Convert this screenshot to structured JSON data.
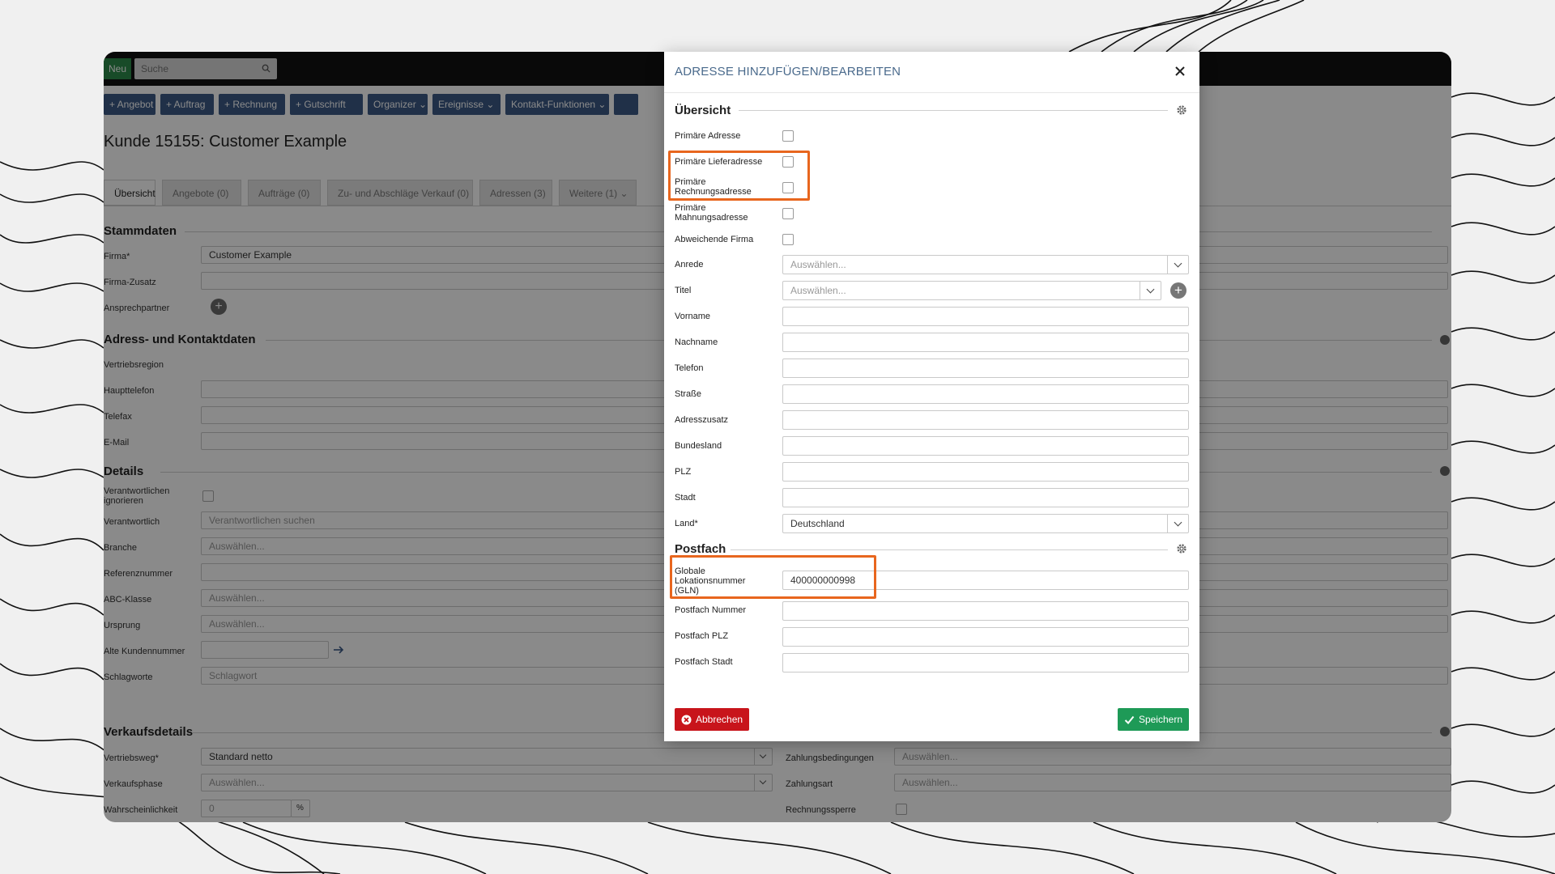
{
  "topbar": {
    "new_label": "Neu",
    "search_placeholder": "Suche"
  },
  "toolbar": {
    "buttons": [
      "+ Angebot",
      "+ Auftrag",
      "+ Rechnung",
      "+ Gutschrift",
      "Organizer ⌄",
      "Ereignisse ⌄",
      "Kontakt-Funktionen ⌄"
    ]
  },
  "page": {
    "title": "Kunde 15155: Customer Example",
    "tabs": [
      "Übersicht",
      "Angebote (0)",
      "Aufträge (0)",
      "Zu- und Abschläge Verkauf (0)",
      "Adressen (3)",
      "Weitere (1) ⌄"
    ],
    "sections": {
      "stammdaten": "Stammdaten",
      "adress": "Adress- und Kontaktdaten",
      "details": "Details",
      "verkauf": "Verkaufsdetails"
    },
    "labels": {
      "firma": "Firma*",
      "firma_zusatz": "Firma-Zusatz",
      "ansprechpartner": "Ansprechpartner",
      "vertriebsregion": "Vertriebsregion",
      "haupttelefon": "Haupttelefon",
      "telefax": "Telefax",
      "email": "E-Mail",
      "verantwortlichen_ignorieren": "Verantwortlichen ignorieren",
      "verantwortlich": "Verantwortlich",
      "branche": "Branche",
      "referenznummer": "Referenznummer",
      "abc_klasse": "ABC-Klasse",
      "ursprung": "Ursprung",
      "alte_kundennummer": "Alte Kundennummer",
      "schlagworte": "Schlagworte",
      "vertriebsweg": "Vertriebsweg*",
      "verkaufsphase": "Verkaufsphase",
      "wahrscheinlichkeit": "Wahrscheinlichkeit",
      "zahlungsbedingungen": "Zahlungsbedingungen",
      "zahlungsart": "Zahlungsart",
      "rechnungssperre": "Rechnungssperre"
    },
    "values": {
      "firma": "Customer Example",
      "verantwortlich_ph": "Verantwortlichen suchen",
      "auswaehlen": "Auswählen...",
      "schlagworte_ph": "Schlagwort",
      "vertriebsweg": "Standard netto",
      "wahrscheinlichkeit": "0",
      "percent": "%"
    }
  },
  "modal": {
    "title": "ADRESSE HINZUFÜGEN/BEARBEITEN",
    "section_overview": "Übersicht",
    "section_postfach": "Postfach",
    "labels": {
      "primaere_adresse": "Primäre Adresse",
      "primaere_lieferadresse": "Primäre Lieferadresse",
      "primaere_rechnungsadresse": "Primäre Rechnungsadresse",
      "primaere_mahnungsadresse": "Primäre Mahnungsadresse",
      "abweichende_firma": "Abweichende Firma",
      "anrede": "Anrede",
      "titel": "Titel",
      "vorname": "Vorname",
      "nachname": "Nachname",
      "telefon": "Telefon",
      "strasse": "Straße",
      "adresszusatz": "Adresszusatz",
      "bundesland": "Bundesland",
      "plz": "PLZ",
      "stadt": "Stadt",
      "land": "Land*",
      "gln": "Globale Lokationsnummer (GLN)",
      "postfach_nummer": "Postfach Nummer",
      "postfach_plz": "Postfach PLZ",
      "postfach_stadt": "Postfach Stadt"
    },
    "values": {
      "anrede_ph": "Auswählen...",
      "titel_ph": "Auswählen...",
      "land": "Deutschland",
      "gln": "400000000998"
    },
    "cancel_label": "Abbrechen",
    "save_label": "Speichern"
  },
  "colors": {
    "highlight": "#e8661e",
    "toolbar_button": "#3c5a86",
    "cancel": "#c8141b",
    "save": "#1e9a57",
    "new_button": "#2e8b4a"
  }
}
